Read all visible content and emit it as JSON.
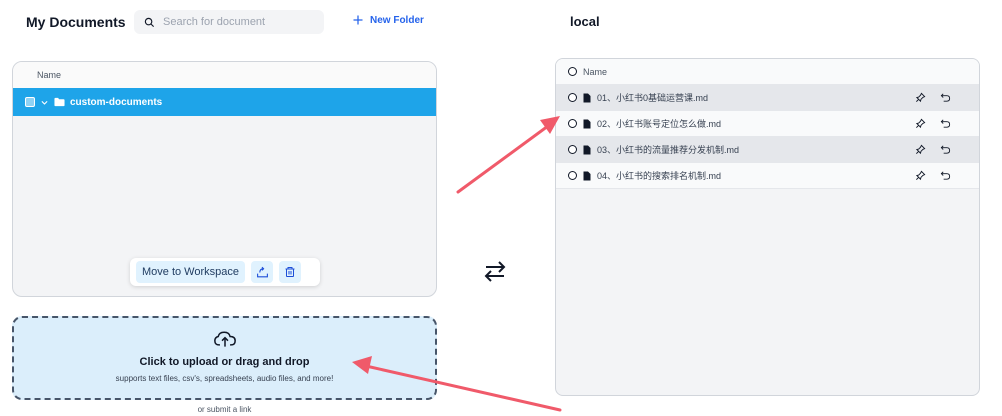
{
  "header": {
    "title": "My Documents",
    "search_placeholder": "Search for document",
    "new_folder_label": "New Folder"
  },
  "left_panel": {
    "column_header": "Name",
    "folder_name": "custom-documents"
  },
  "actions": {
    "move_label": "Move to Workspace"
  },
  "upload": {
    "title": "Click to upload or drag and drop",
    "subtitle": "supports text files, csv's, spreadsheets, audio files, and more!",
    "submit_link": "or submit a link"
  },
  "workspace": {
    "title": "local",
    "column_header": "Name",
    "files": [
      {
        "name": "01、小红书0基础运营课.md"
      },
      {
        "name": "02、小红书账号定位怎么做.md"
      },
      {
        "name": "03、小红书的流量推荐分发机制.md"
      },
      {
        "name": "04、小红书的搜索排名机制.md"
      }
    ]
  },
  "colors": {
    "accent": "#1ea4e9",
    "link": "#2563eb",
    "annotation": "#f05a6a",
    "upload_bg": "#dbeefb"
  }
}
